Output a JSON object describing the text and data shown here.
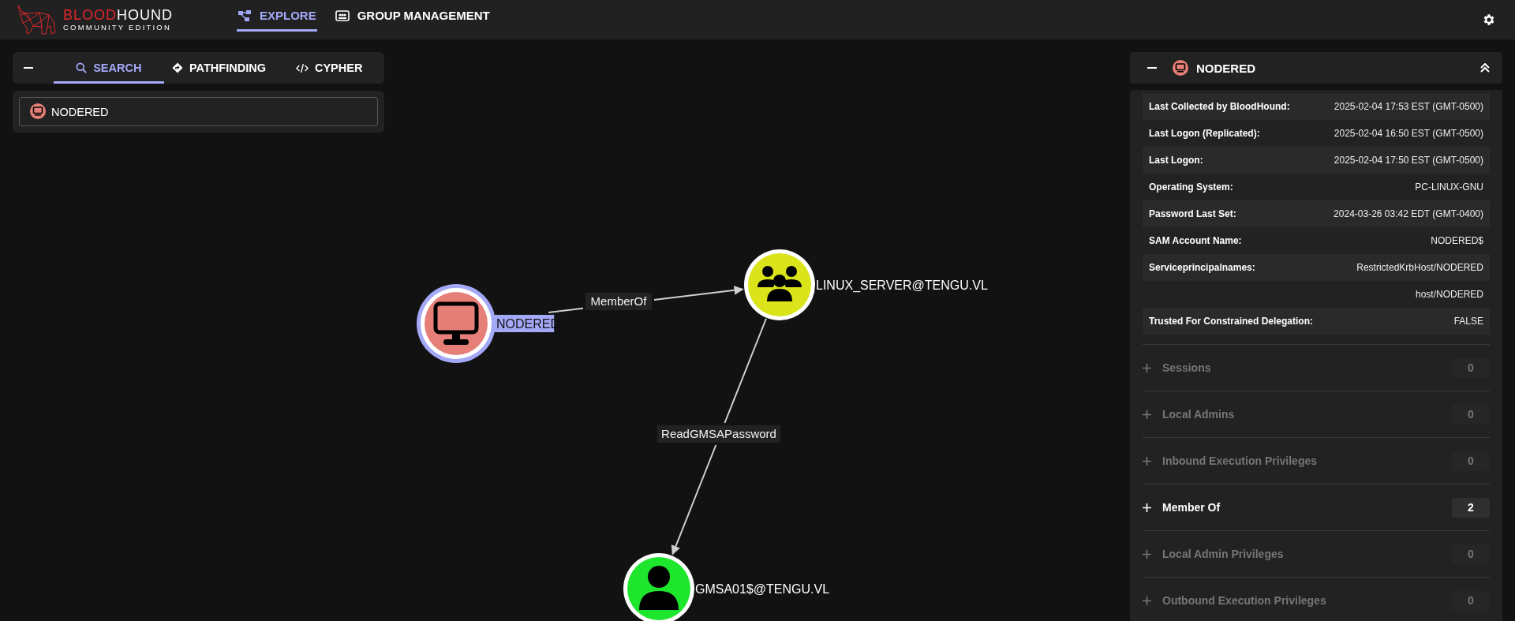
{
  "header": {
    "logo": {
      "name_accent": "BLOOD",
      "name_rest": "HOUND",
      "subtitle": "COMMUNITY EDITION"
    },
    "nav": [
      {
        "label": "EXPLORE",
        "selected": true
      },
      {
        "label": "GROUP MANAGEMENT",
        "selected": false
      }
    ]
  },
  "search_panel": {
    "tabs": [
      {
        "label": "SEARCH",
        "selected": true
      },
      {
        "label": "PATHFINDING",
        "selected": false
      },
      {
        "label": "CYPHER",
        "selected": false
      }
    ],
    "search": {
      "value": "NODERED"
    }
  },
  "graph": {
    "nodes": [
      {
        "label": "NODERED",
        "kind": "computer",
        "highlighted": true
      },
      {
        "label": "LINUX_SERVER@TENGU.VL",
        "kind": "group",
        "highlighted": false
      },
      {
        "label": "GMSA01$@TENGU.VL",
        "kind": "user",
        "highlighted": false
      }
    ],
    "edges": [
      {
        "label": "MemberOf"
      },
      {
        "label": "ReadGMSAPassword"
      }
    ]
  },
  "entity_panel": {
    "title": "NODERED",
    "properties": [
      {
        "label": "Last Collected by BloodHound:",
        "values": [
          "2025-02-04 17:53 EST (GMT-0500)"
        ]
      },
      {
        "label": "Last Logon (Replicated):",
        "values": [
          "2025-02-04 16:50 EST (GMT-0500)"
        ]
      },
      {
        "label": "Last Logon:",
        "values": [
          "2025-02-04 17:50 EST (GMT-0500)"
        ]
      },
      {
        "label": "Operating System:",
        "values": [
          "PC-LINUX-GNU"
        ]
      },
      {
        "label": "Password Last Set:",
        "values": [
          "2024-03-26 03:42 EDT (GMT-0400)"
        ]
      },
      {
        "label": "SAM Account Name:",
        "values": [
          "NODERED$"
        ]
      },
      {
        "label": "Serviceprincipalnames:",
        "values": [
          "RestrictedKrbHost/NODERED",
          "host/NODERED"
        ]
      },
      {
        "label": "Trusted For Constrained Delegation:",
        "values": [
          "FALSE"
        ]
      }
    ],
    "sections": [
      {
        "label": "Sessions",
        "count": "0",
        "enabled": false
      },
      {
        "label": "Local Admins",
        "count": "0",
        "enabled": false
      },
      {
        "label": "Inbound Execution Privileges",
        "count": "0",
        "enabled": false
      },
      {
        "label": "Member Of",
        "count": "2",
        "enabled": true
      },
      {
        "label": "Local Admin Privileges",
        "count": "0",
        "enabled": false
      },
      {
        "label": "Outbound Execution Privileges",
        "count": "0",
        "enabled": false
      }
    ]
  }
}
